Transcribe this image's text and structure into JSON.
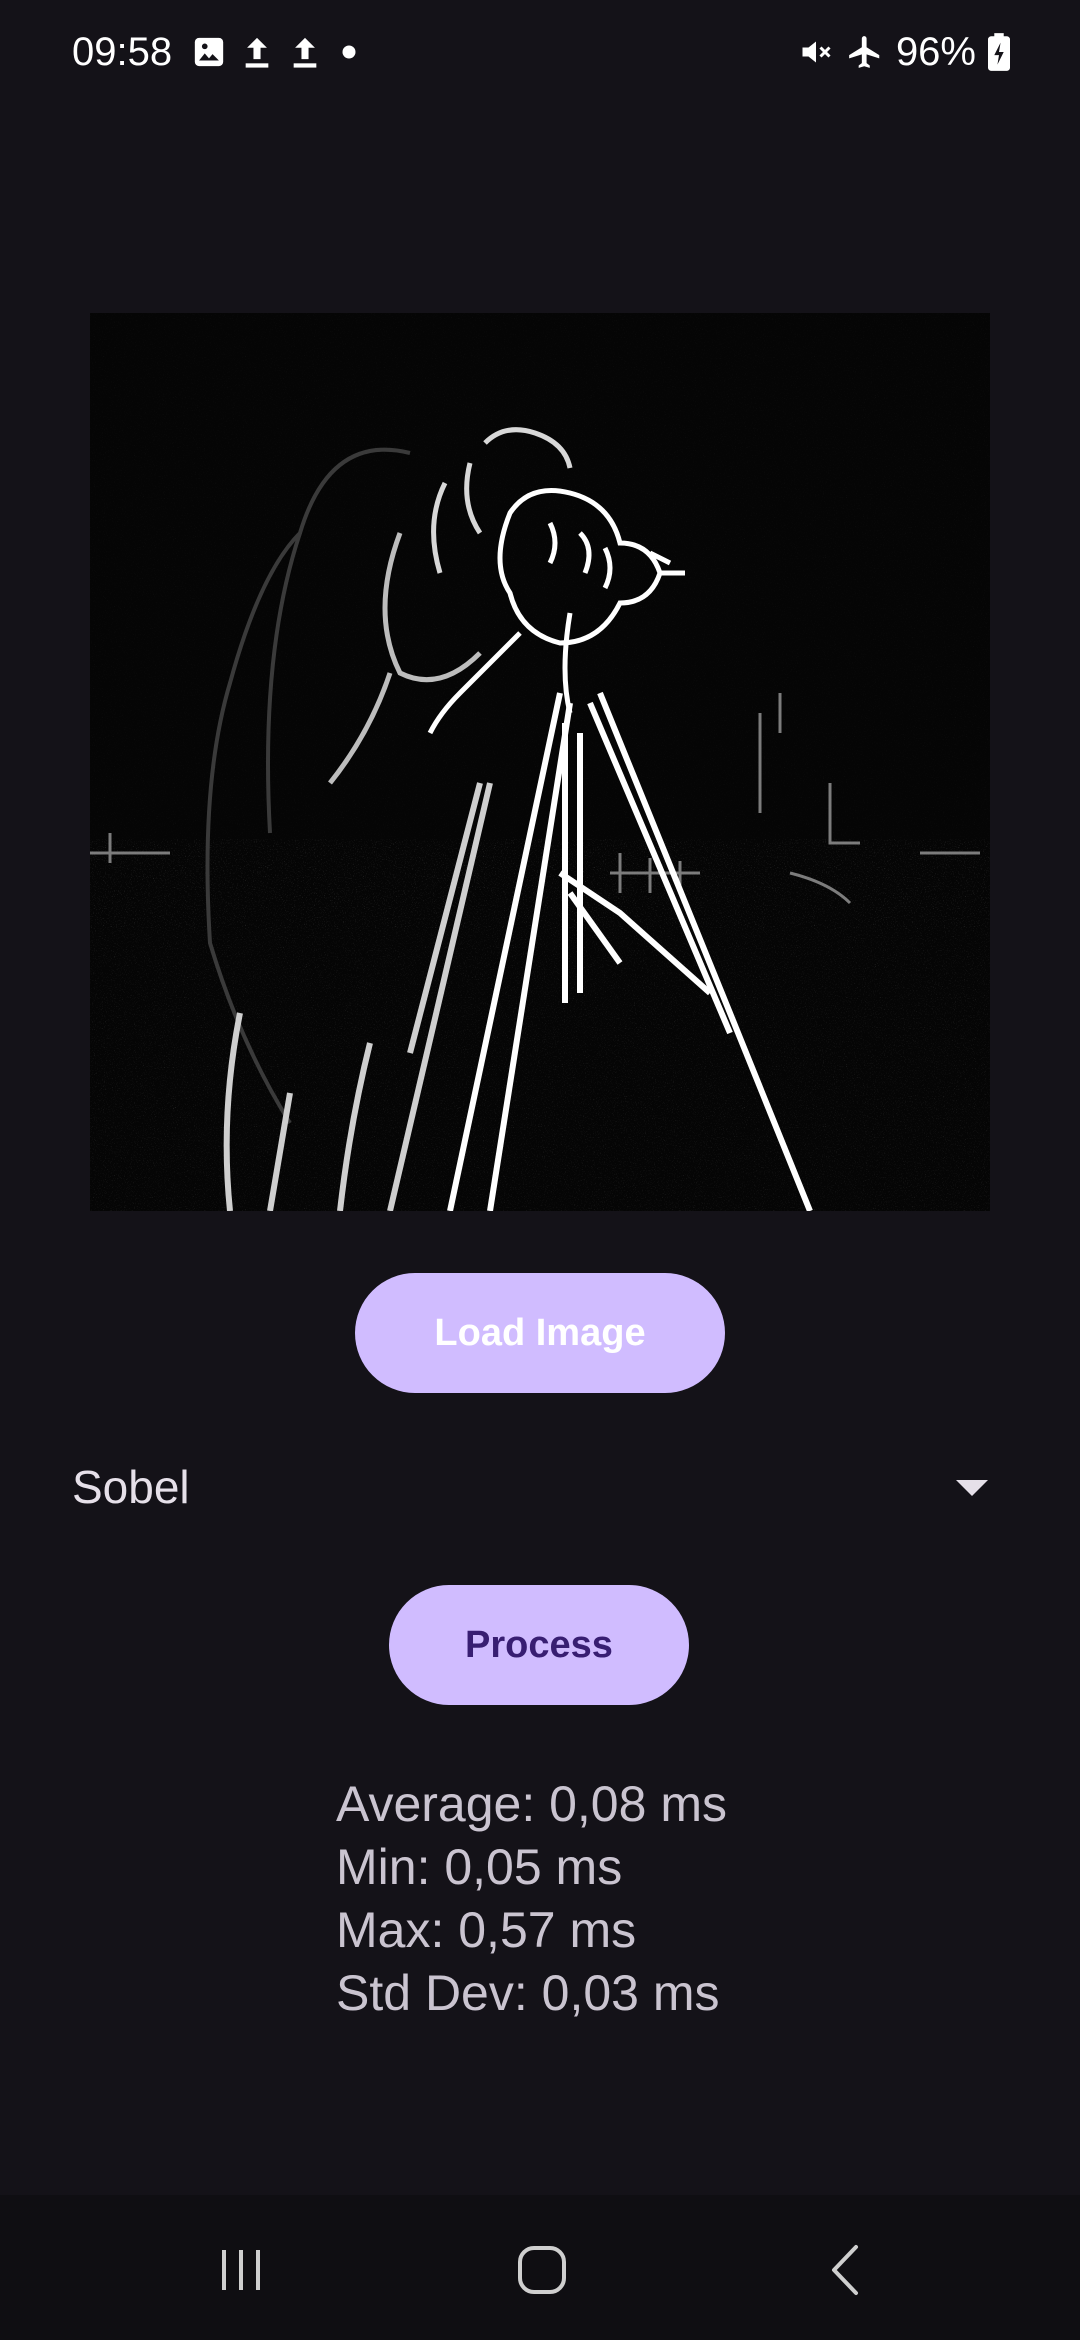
{
  "status_bar": {
    "time": "09:58",
    "left_icons": [
      "image-icon",
      "upload-icon",
      "upload-icon",
      "dot-icon"
    ],
    "right_icons": [
      "mute-icon",
      "airplane-icon"
    ],
    "battery": "96%"
  },
  "image": {
    "description_icon": "edge-detected-cameraman-image"
  },
  "buttons": {
    "load_image": "Load Image",
    "process": "Process"
  },
  "filter_dropdown": {
    "selected": "Sobel"
  },
  "stats": {
    "average": "Average: 0,08 ms",
    "min": "Min: 0,05 ms",
    "max": "Max: 0,57 ms",
    "std_dev": "Std Dev: 0,03 ms"
  },
  "nav_bar": {
    "icons": [
      "recents-icon",
      "home-icon",
      "back-icon"
    ]
  },
  "colors": {
    "background": "#141218",
    "button": "#d0bcff",
    "process_text": "#381e72"
  }
}
